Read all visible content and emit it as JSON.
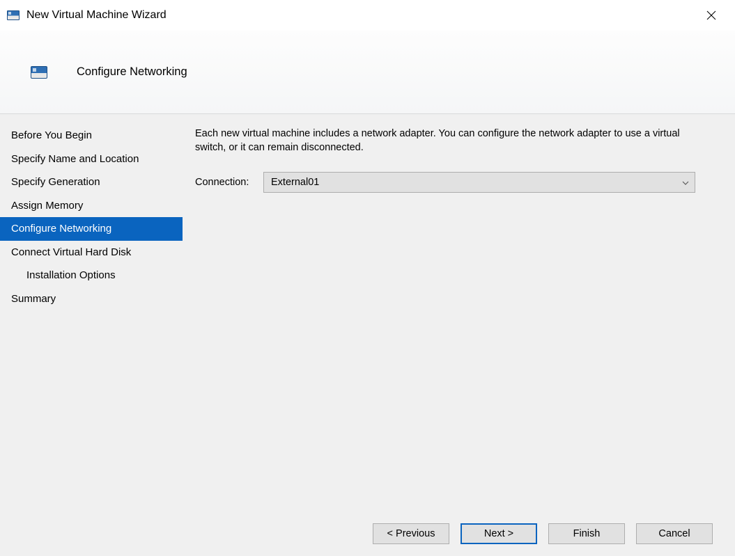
{
  "window": {
    "title": "New Virtual Machine Wizard"
  },
  "header": {
    "page_title": "Configure Networking"
  },
  "steps": [
    {
      "label": "Before You Begin",
      "active": false,
      "indent": false
    },
    {
      "label": "Specify Name and Location",
      "active": false,
      "indent": false
    },
    {
      "label": "Specify Generation",
      "active": false,
      "indent": false
    },
    {
      "label": "Assign Memory",
      "active": false,
      "indent": false
    },
    {
      "label": "Configure Networking",
      "active": true,
      "indent": false
    },
    {
      "label": "Connect Virtual Hard Disk",
      "active": false,
      "indent": false
    },
    {
      "label": "Installation Options",
      "active": false,
      "indent": true
    },
    {
      "label": "Summary",
      "active": false,
      "indent": false
    }
  ],
  "pane": {
    "intro": "Each new virtual machine includes a network adapter. You can configure the network adapter to use a virtual switch, or it can remain disconnected.",
    "connection_label": "Connection:",
    "connection_value": "External01"
  },
  "buttons": {
    "previous": "< Previous",
    "next": "Next >",
    "finish": "Finish",
    "cancel": "Cancel"
  }
}
